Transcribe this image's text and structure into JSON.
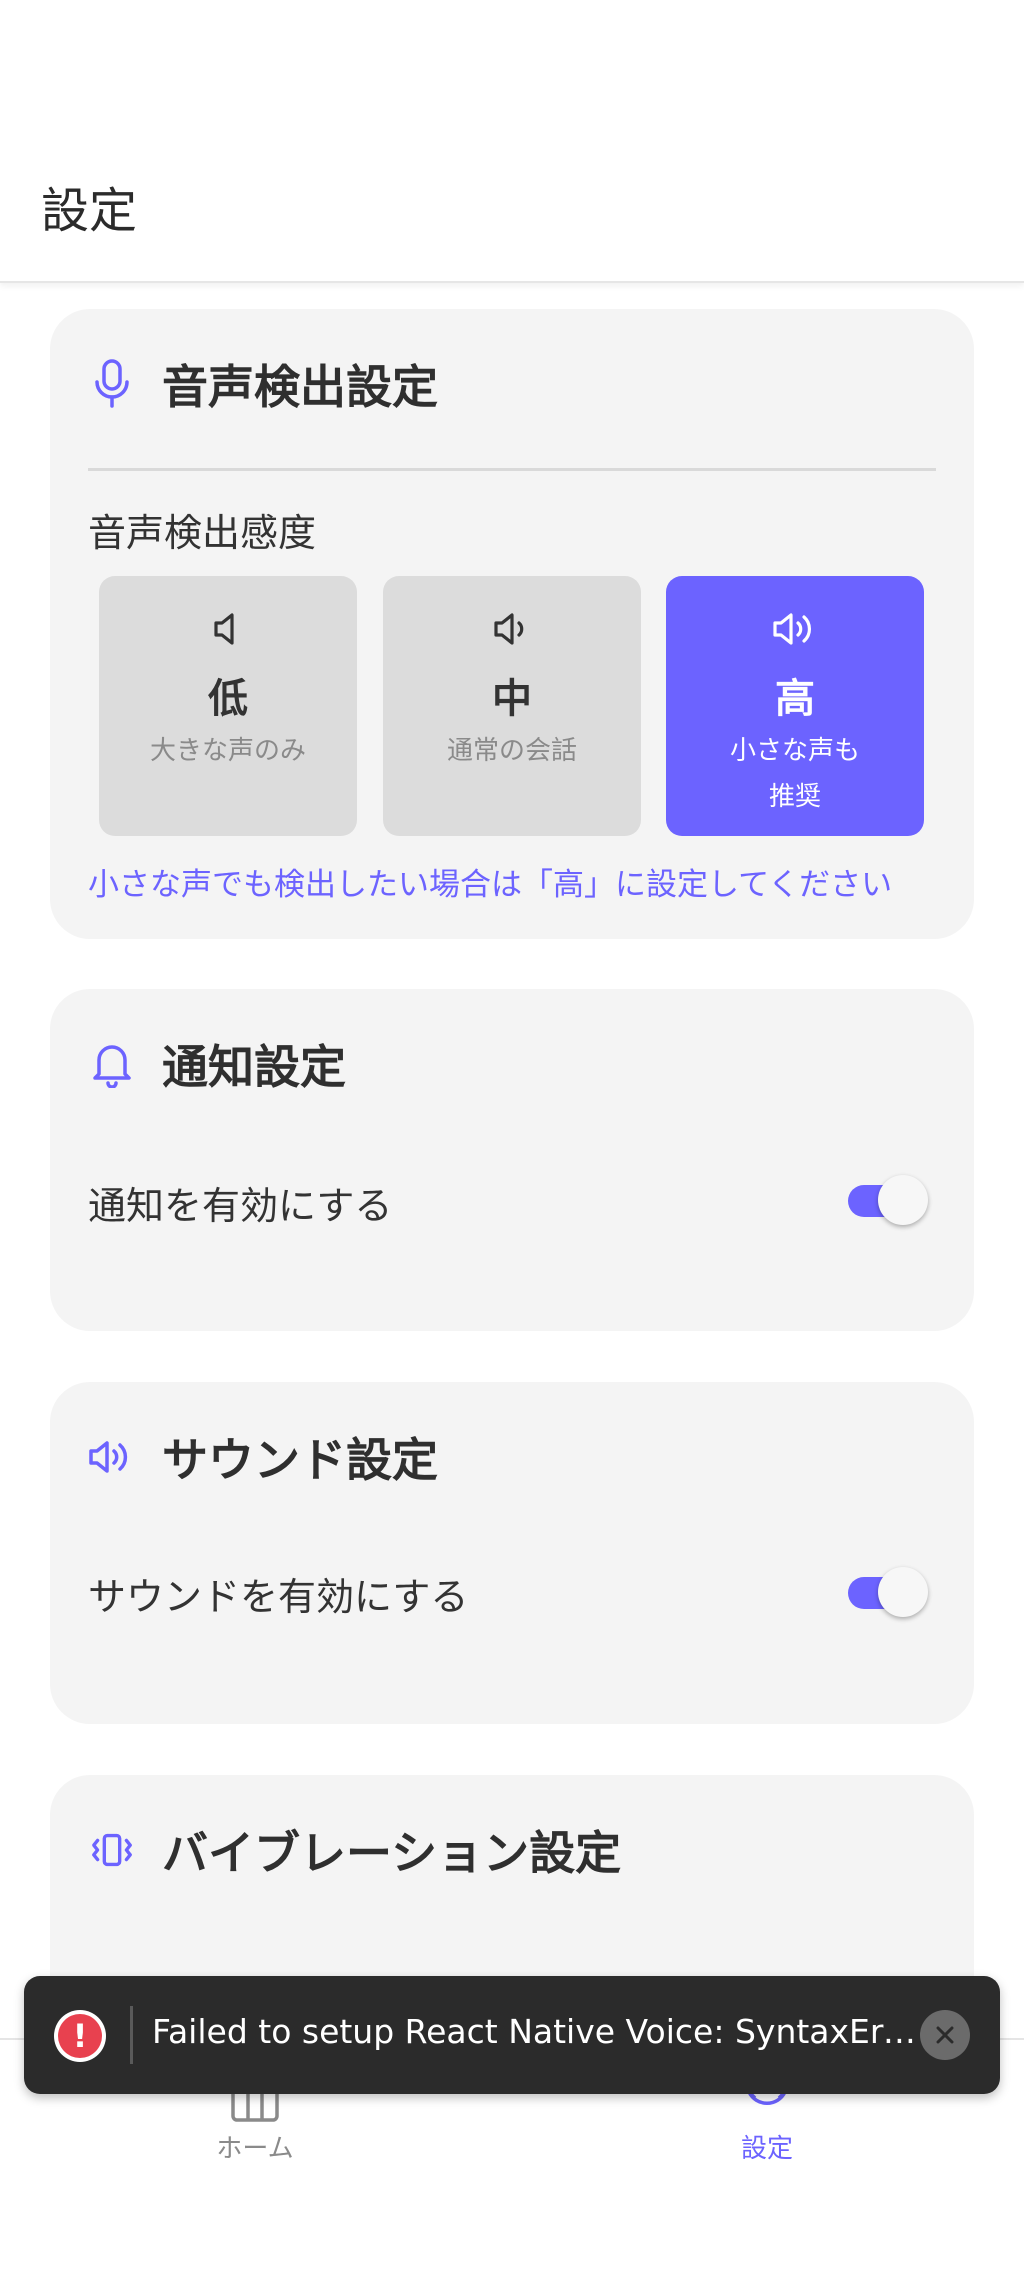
{
  "header": {
    "title": "設定"
  },
  "voice": {
    "title": "音声検出設定",
    "icon": "microphone-icon",
    "sensitivity_label": "音声検出感度",
    "levels": [
      {
        "name": "低",
        "desc": "大きな声のみ",
        "icon": "speaker-low-icon",
        "selected": false
      },
      {
        "name": "中",
        "desc": "通常の会話",
        "icon": "speaker-medium-icon",
        "selected": false
      },
      {
        "name": "高",
        "desc": "小さな声も\n推奨",
        "icon": "speaker-high-icon",
        "selected": true
      }
    ],
    "hint": "小さな声でも検出したい場合は「高」に設定してください"
  },
  "notification": {
    "title": "通知設定",
    "icon": "bell-icon",
    "toggle_label": "通知を有効にする",
    "enabled": true
  },
  "sound": {
    "title": "サウンド設定",
    "icon": "speaker-icon",
    "toggle_label": "サウンドを有効にする",
    "enabled": true
  },
  "vibration": {
    "title": "バイブレーション設定",
    "icon": "vibration-icon"
  },
  "nav": {
    "home_label": "ホーム",
    "settings_label": "設定",
    "active": "settings"
  },
  "toast": {
    "message": "Failed to setup React Native Voice: SyntaxError...",
    "icon": "alert-icon"
  },
  "colors": {
    "accent": "#6c63ff",
    "card_bg": "#f4f4f4",
    "error": "#e8414f",
    "toast_bg": "#2b2b2b"
  }
}
